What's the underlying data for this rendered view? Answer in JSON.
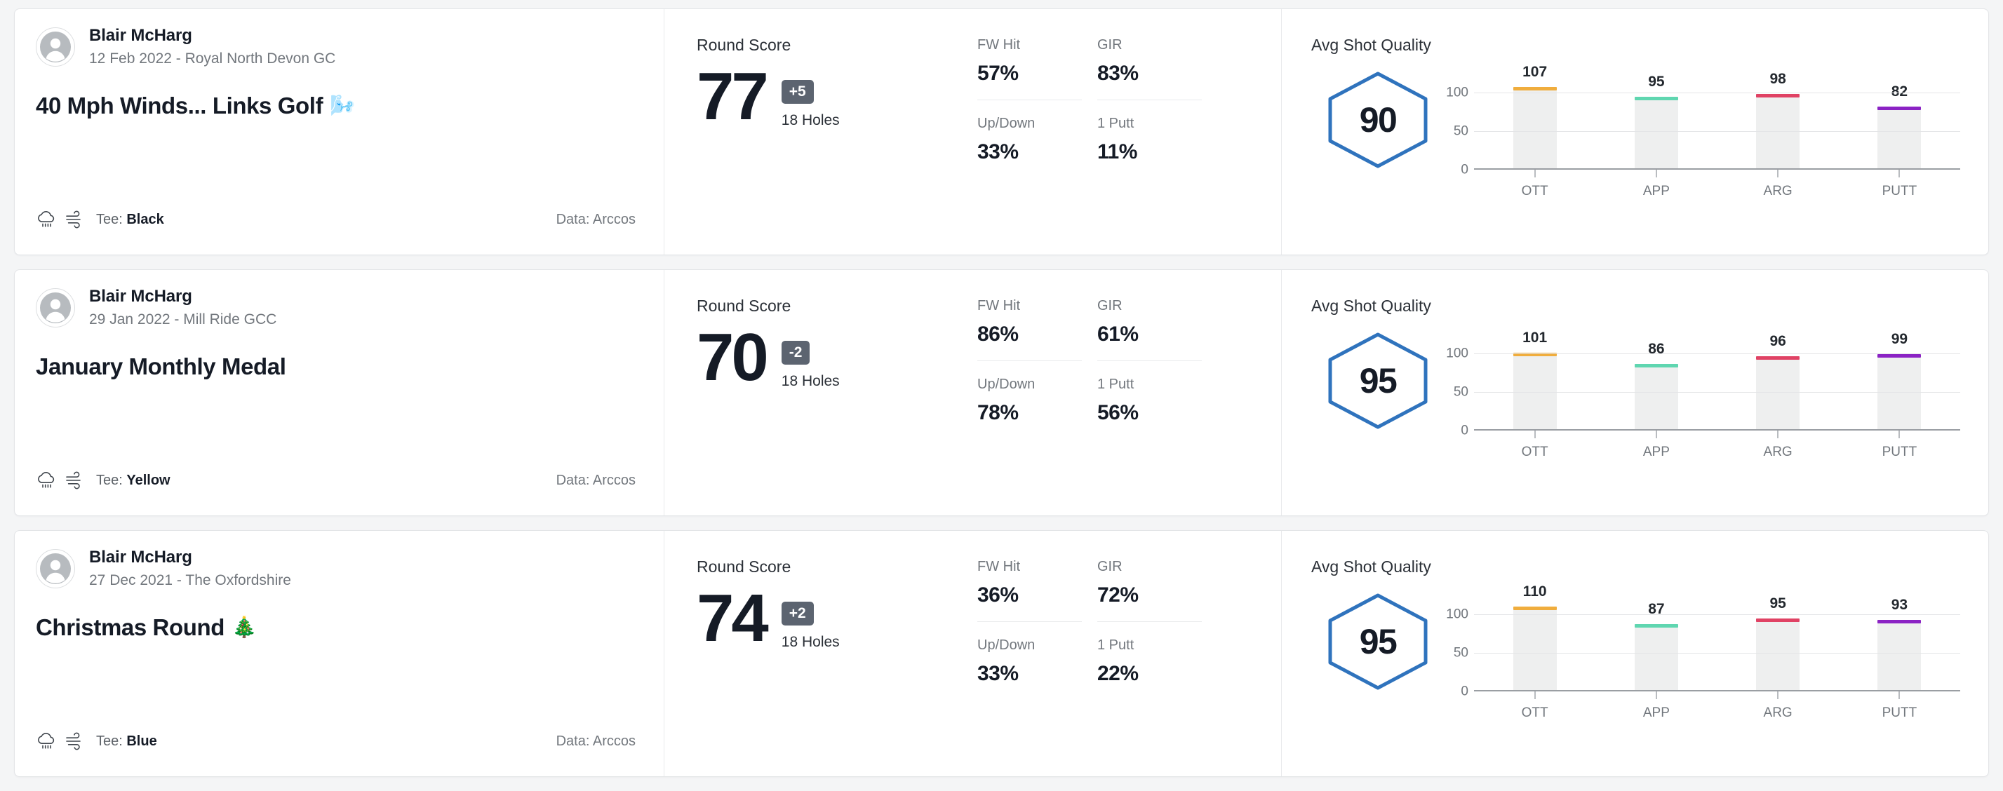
{
  "labels": {
    "round_score": "Round Score",
    "holes": "18 Holes",
    "avg_shot_quality": "Avg Shot Quality",
    "tee_prefix": "Tee: ",
    "fw_hit": "FW Hit",
    "gir": "GIR",
    "up_down": "Up/Down",
    "one_putt": "1 Putt"
  },
  "colors": {
    "hexagon": "#2f73bd",
    "badge_bg": "#5c6470",
    "bar_fill": "#eeefef",
    "ott": "#f0ad3d",
    "app": "#5fd6b0",
    "arg": "#e04264",
    "putt": "#8b23c4",
    "card_bg": "#ffffff",
    "page_bg": "#f4f5f6"
  },
  "icons": {
    "weather": "rain-cloud-icon",
    "wind": "wind-icon",
    "avatar": "user-avatar-icon"
  },
  "rounds": [
    {
      "player": "Blair McHarg",
      "meta": "12 Feb 2022 - Royal North Devon GC",
      "title": "40 Mph Winds... Links Golf",
      "title_emoji": "🌬️",
      "tee": "Black",
      "data_source": "Data: Arccos",
      "score": "77",
      "par_diff": "+5",
      "holes": "18 Holes",
      "stats": {
        "fw_hit": "57%",
        "gir": "83%",
        "up_down": "33%",
        "one_putt": "11%"
      },
      "avg_shot_quality": "90",
      "chart_data": {
        "type": "bar",
        "title": "Avg Shot Quality",
        "categories": [
          "OTT",
          "APP",
          "ARG",
          "PUTT"
        ],
        "values": [
          107,
          95,
          98,
          82
        ],
        "colors": [
          "#f0ad3d",
          "#5fd6b0",
          "#e04264",
          "#8b23c4"
        ],
        "yticks": [
          100,
          50,
          0
        ],
        "ylim": [
          0,
          120
        ],
        "xlabel": "",
        "ylabel": "",
        "grid": true,
        "legend": "none"
      }
    },
    {
      "player": "Blair McHarg",
      "meta": "29 Jan 2022 - Mill Ride GCC",
      "title": "January Monthly Medal",
      "title_emoji": "",
      "tee": "Yellow",
      "data_source": "Data: Arccos",
      "score": "70",
      "par_diff": "-2",
      "holes": "18 Holes",
      "stats": {
        "fw_hit": "86%",
        "gir": "61%",
        "up_down": "78%",
        "one_putt": "56%"
      },
      "avg_shot_quality": "95",
      "chart_data": {
        "type": "bar",
        "title": "Avg Shot Quality",
        "categories": [
          "OTT",
          "APP",
          "ARG",
          "PUTT"
        ],
        "values": [
          101,
          86,
          96,
          99
        ],
        "colors": [
          "#f0ad3d",
          "#5fd6b0",
          "#e04264",
          "#8b23c4"
        ],
        "yticks": [
          100,
          50,
          0
        ],
        "ylim": [
          0,
          120
        ],
        "xlabel": "",
        "ylabel": "",
        "grid": true,
        "legend": "none"
      }
    },
    {
      "player": "Blair McHarg",
      "meta": "27 Dec 2021 - The Oxfordshire",
      "title": "Christmas Round",
      "title_emoji": "🎄",
      "tee": "Blue",
      "data_source": "Data: Arccos",
      "score": "74",
      "par_diff": "+2",
      "holes": "18 Holes",
      "stats": {
        "fw_hit": "36%",
        "gir": "72%",
        "up_down": "33%",
        "one_putt": "22%"
      },
      "avg_shot_quality": "95",
      "chart_data": {
        "type": "bar",
        "title": "Avg Shot Quality",
        "categories": [
          "OTT",
          "APP",
          "ARG",
          "PUTT"
        ],
        "values": [
          110,
          87,
          95,
          93
        ],
        "colors": [
          "#f0ad3d",
          "#5fd6b0",
          "#e04264",
          "#8b23c4"
        ],
        "yticks": [
          100,
          50,
          0
        ],
        "ylim": [
          0,
          120
        ],
        "xlabel": "",
        "ylabel": "",
        "grid": true,
        "legend": "none"
      }
    }
  ]
}
